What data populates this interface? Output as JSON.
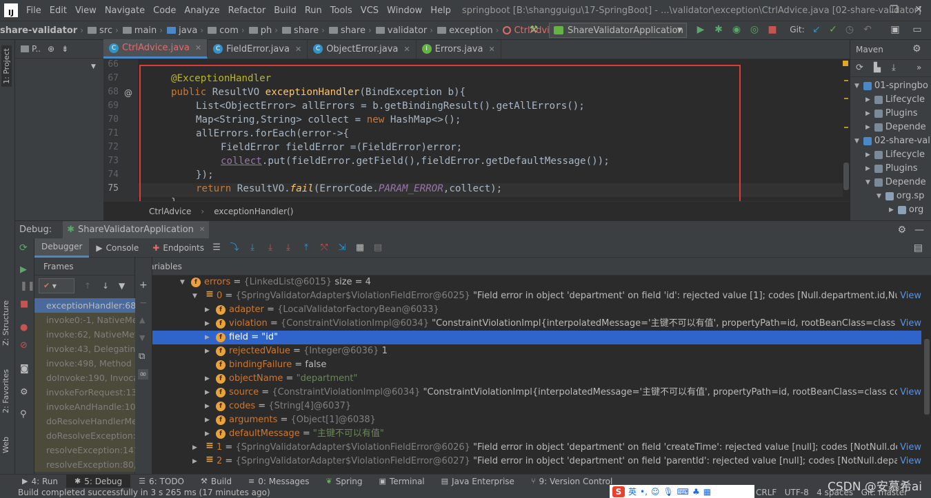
{
  "menubar": {
    "items": [
      "File",
      "Edit",
      "View",
      "Navigate",
      "Code",
      "Analyze",
      "Refactor",
      "Build",
      "Run",
      "Tools",
      "VCS",
      "Window",
      "Help"
    ],
    "window_title": "springboot [B:\\shangguigu\\17-SpringBoot] - ...\\validator\\exception\\CtrlAdvice.java [02-share-validator]"
  },
  "navbar": {
    "crumbs": [
      "share-validator",
      "src",
      "main",
      "java",
      "com",
      "ph",
      "share",
      "share",
      "validator",
      "exception",
      "CtrlAdvice"
    ],
    "run_config": "ShareValidatorApplication",
    "git_label": "Git:"
  },
  "left_stripe": {
    "project": "1: Project",
    "structure": "Z: Structure",
    "favorites": "2: Favorites",
    "web": "Web"
  },
  "project_panel": {
    "label": "P.."
  },
  "editor_tabs": [
    {
      "label": "CtrlAdvice.java",
      "active": true,
      "color": "#3592c4"
    },
    {
      "label": "FieldError.java",
      "active": false,
      "color": "#3592c4"
    },
    {
      "label": "ObjectError.java",
      "active": false,
      "color": "#3592c4"
    },
    {
      "label": "Errors.java",
      "active": false,
      "color": "#62b543"
    }
  ],
  "editor": {
    "line_numbers": [
      "66",
      "67",
      "68",
      "69",
      "70",
      "71",
      "72",
      "73",
      "74",
      "75",
      ""
    ],
    "gutter_marker_line": "68",
    "gutter_marker": "@"
  },
  "code": {
    "l67": "@ExceptionHandler",
    "l68_kw": "public",
    "l68_type": " ResultVO ",
    "l68_fn": "exceptionHandler",
    "l68_rest": "(BindException b){",
    "l69": "List<ObjectError> allErrors = b.getBindingResult().getAllErrors();",
    "l70_a": "Map<String,String> collect = ",
    "l70_kw": "new",
    "l70_b": " HashMap<>();",
    "l71": "allErrors.forEach(error->{",
    "l72": "FieldError fieldError =(FieldError)error;",
    "l73_u": "collect",
    "l73_b": ".put(fieldError.getField(),fieldError.getDefaultMessage());",
    "l74": "});",
    "l75_kw": "return",
    "l75_a": " ResultVO.",
    "l75_it": "fail",
    "l75_b": "(ErrorCode.",
    "l75_cn": "PARAM_ERROR",
    "l75_c": ",collect);",
    "l76": "}"
  },
  "breadcrumb": {
    "class": "CtrlAdvice",
    "method": "exceptionHandler()"
  },
  "maven": {
    "title": "Maven",
    "rows": [
      "01-springbo",
      "Lifecycle",
      "Plugins",
      "Depende",
      "02-share-val",
      "Lifecycle",
      "Plugins",
      "Depende",
      "org.sp",
      "org"
    ]
  },
  "debug": {
    "label": "Debug:",
    "session": "ShareValidatorApplication",
    "tabs": [
      "Debugger",
      "Console",
      "Endpoints"
    ],
    "frames_label": "Frames",
    "variables_label": "Variables",
    "frames": [
      "exceptionHandler:68,",
      "invoke0:-1, NativeMet",
      "invoke:62, NativeMeth",
      "invoke:43, DelegatingI",
      "invoke:498, Method (j",
      "doInvoke:190, Invocal",
      "invokeForRequest:138",
      "invokeAndHandle:105,",
      "doResolveHandlerMet",
      "doResolveException:6",
      "resolveException:141,",
      "resolveException:80, H"
    ],
    "variables": [
      {
        "name": "errors",
        "eq": " = ",
        "ref": "{LinkedList@6015}",
        "val": " size = 4"
      },
      {
        "name": "0",
        "eq": " = ",
        "ref": "{SpringValidatorAdapter$ViolationFieldError@6025}",
        "val": " \"Field error in object 'department' on field 'id': rejected value [1]; codes [Null.department.id,Null.id,Null.java.lang.I..."
      },
      {
        "name": "adapter",
        "eq": " = ",
        "ref": "{LocalValidatorFactoryBean@6033}",
        "val": ""
      },
      {
        "name": "violation",
        "eq": " = ",
        "ref": "{ConstraintViolationImpl@6034}",
        "val": " \"ConstraintViolationImpl{interpolatedMessage='主键不可以有值', propertyPath=id, rootBeanClass=class com.ph.share.share..."
      },
      {
        "name": "field",
        "eq": " = ",
        "ref": "",
        "val": "\"id\""
      },
      {
        "name": "rejectedValue",
        "eq": " = ",
        "ref": "{Integer@6036}",
        "val": " 1"
      },
      {
        "name": "bindingFailure",
        "eq": " = ",
        "ref": "",
        "val": "false"
      },
      {
        "name": "objectName",
        "eq": " = ",
        "ref": "",
        "val": "\"department\""
      },
      {
        "name": "source",
        "eq": " = ",
        "ref": "{ConstraintViolationImpl@6034}",
        "val": " \"ConstraintViolationImpl{interpolatedMessage='主键不可以有值', propertyPath=id, rootBeanClass=class com.ph.share.share.v..."
      },
      {
        "name": "codes",
        "eq": " = ",
        "ref": "{String[4]@6037}",
        "val": ""
      },
      {
        "name": "arguments",
        "eq": " = ",
        "ref": "{Object[1]@6038}",
        "val": ""
      },
      {
        "name": "defaultMessage",
        "eq": " = ",
        "ref": "",
        "val": "\"主键不可以有值\""
      },
      {
        "name": "1",
        "eq": " = ",
        "ref": "{SpringValidatorAdapter$ViolationFieldError@6026}",
        "val": " \"Field error in object 'department' on field 'createTime': rejected value [null]; codes [NotNull.department.createTi..."
      },
      {
        "name": "2",
        "eq": " = ",
        "ref": "{SpringValidatorAdapter$ViolationFieldError@6027}",
        "val": " \"Field error in object 'department' on field 'parentId': rejected value [null]; codes [NotNull.department.parentId,N..."
      }
    ],
    "view_link": "View"
  },
  "bottom_tabs": [
    "4: Run",
    "5: Debug",
    "6: TODO",
    "Build",
    "0: Messages",
    "Spring",
    "Terminal",
    "Java Enterprise",
    "9: Version Control"
  ],
  "status": {
    "message": "Build completed successfully in 3 s 265 ms (17 minutes ago)",
    "line_sep": "CRLF",
    "encoding": "UTF-8",
    "indent": "4 spaces",
    "git": "Git: master"
  },
  "ime": {
    "lang": "英"
  },
  "watermark": "CSDN @安慕希ai"
}
